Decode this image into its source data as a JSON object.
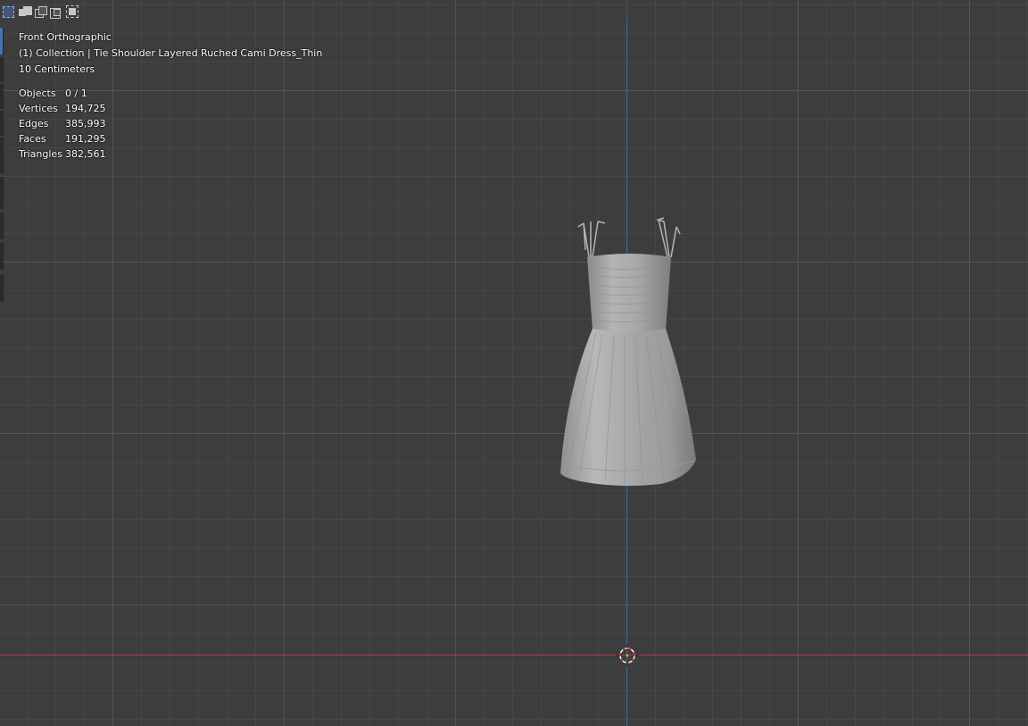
{
  "viewport": {
    "view_name": "Front Orthographic",
    "collection": "(1) Collection | Tie Shoulder Layered Ruched Cami Dress_Thin",
    "scale": "10 Centimeters"
  },
  "stats": {
    "objects": {
      "label": "Objects",
      "value": "0 / 1"
    },
    "vertices": {
      "label": "Vertices",
      "value": "194,725"
    },
    "edges": {
      "label": "Edges",
      "value": "385,993"
    },
    "faces": {
      "label": "Faces",
      "value": "191,295"
    },
    "triangles": {
      "label": "Triangles",
      "value": "382,561"
    }
  },
  "toolbar": {
    "select_modes": [
      "select-new-icon",
      "select-extend-icon",
      "select-subtract-icon",
      "select-invert-icon",
      "select-intersect-icon"
    ],
    "active_mode": "select-new-icon"
  },
  "colors": {
    "background": "#3d3d3d",
    "x_axis": "#b03a44",
    "z_axis": "#3f6d9c",
    "accent": "#4772b3"
  }
}
